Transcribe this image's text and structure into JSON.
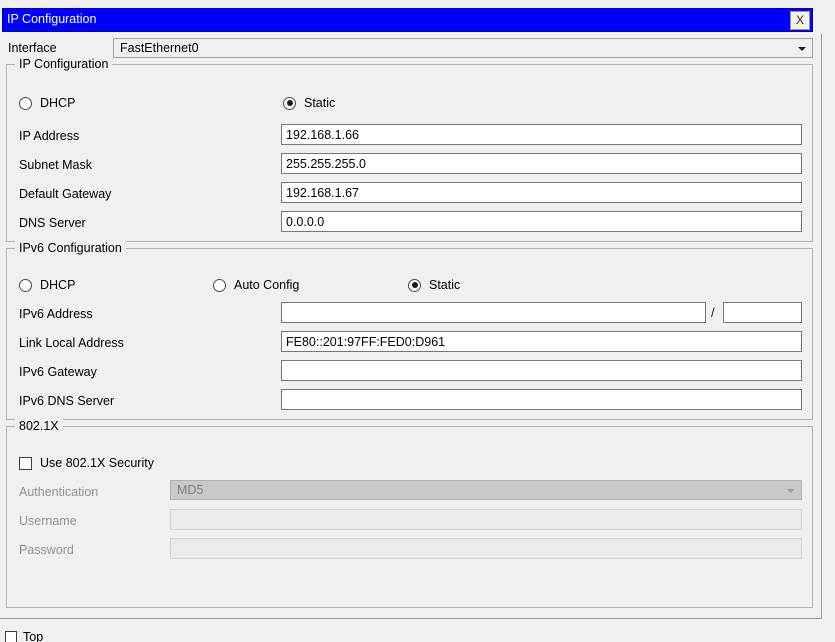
{
  "window": {
    "title": "IP Configuration",
    "close_label": "X",
    "title_bar_color": "#0000ff",
    "title_text_color": "#ffffff"
  },
  "interface": {
    "label": "Interface",
    "value": "FastEthernet0"
  },
  "ip_configuration": {
    "group_title": "IP Configuration",
    "mode": {
      "dhcp_label": "DHCP",
      "dhcp_selected": false,
      "static_label": "Static",
      "static_selected": true
    },
    "fields": {
      "ip_address_label": "IP Address",
      "ip_address_value": "192.168.1.66",
      "subnet_mask_label": "Subnet Mask",
      "subnet_mask_value": "255.255.255.0",
      "default_gateway_label": "Default Gateway",
      "default_gateway_value": "192.168.1.67",
      "dns_server_label": "DNS Server",
      "dns_server_value": "0.0.0.0"
    }
  },
  "ipv6_configuration": {
    "group_title": "IPv6 Configuration",
    "mode": {
      "dhcp_label": "DHCP",
      "dhcp_selected": false,
      "auto_config_label": "Auto Config",
      "auto_config_selected": false,
      "static_label": "Static",
      "static_selected": true
    },
    "fields": {
      "ipv6_address_label": "IPv6 Address",
      "ipv6_address_value": "",
      "prefix_separator": "/",
      "prefix_length_value": "",
      "link_local_label": "Link Local Address",
      "link_local_value": "FE80::201:97FF:FED0:D961",
      "ipv6_gateway_label": "IPv6 Gateway",
      "ipv6_gateway_value": "",
      "ipv6_dns_label": "IPv6 DNS Server",
      "ipv6_dns_value": ""
    }
  },
  "dot1x": {
    "group_title": "802.1X",
    "use_security_label": "Use 802.1X Security",
    "use_security_checked": false,
    "authentication_label": "Authentication",
    "authentication_value": "MD5",
    "username_label": "Username",
    "username_value": "",
    "password_label": "Password",
    "password_value": ""
  },
  "bottom": {
    "top_checkbox_label": "Top",
    "top_checkbox_checked": false
  }
}
